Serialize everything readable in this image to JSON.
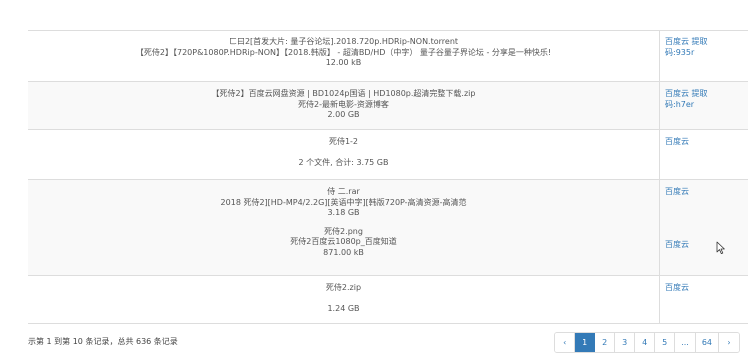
{
  "rows": [
    {
      "lines": [
        "ㄈ曰2[首发大片: 量子谷论坛].2018.720p.HDRip-NON.torrent",
        "【死侍2】【720P&1080P.HDRip-NON】【2018.韩版】 - 超清BD/HD（中字） 量子谷量子界论坛 - 分享是一种快乐!",
        "12.00 kB"
      ],
      "link_lines": [
        "百度云 提取",
        "码:935r"
      ]
    },
    {
      "lines": [
        "【死侍2】百度云网盘资源 | BD1024p国语 | HD1080p.超清完整下载.zip",
        "死侍2-最新电影-资源博客",
        "2.00 GB"
      ],
      "link_lines": [
        "百度云 提取",
        "码:h7er"
      ]
    },
    {
      "lines": [
        "死侍1-2"
      ],
      "gap": true,
      "after_gap": "2 个文件, 合计: 3.75 GB",
      "link_lines": [
        "百度云"
      ]
    },
    {
      "entries": [
        {
          "lines": [
            "侍 二.rar",
            "2018 死侍2][HD-MP4/2.2G][英语中字][韩版720P-高清资源-高清范",
            "3.18 GB"
          ],
          "link": "百度云"
        },
        {
          "lines": [
            "死侍2.png",
            "死侍2百度云1080p_百度知道",
            "871.00 kB"
          ],
          "link": "百度云"
        }
      ]
    },
    {
      "lines": [
        "死侍2.zip"
      ],
      "gap": true,
      "after_gap": "1.24 GB",
      "link_lines": [
        "百度云"
      ]
    }
  ],
  "footer": {
    "info": "示第 1 到第 10 条记录，总共 636 条记录"
  },
  "pagination": {
    "prev": "‹",
    "pages": [
      "1",
      "2",
      "3",
      "4",
      "5",
      "...",
      "64"
    ],
    "next": "›",
    "active": "1"
  }
}
